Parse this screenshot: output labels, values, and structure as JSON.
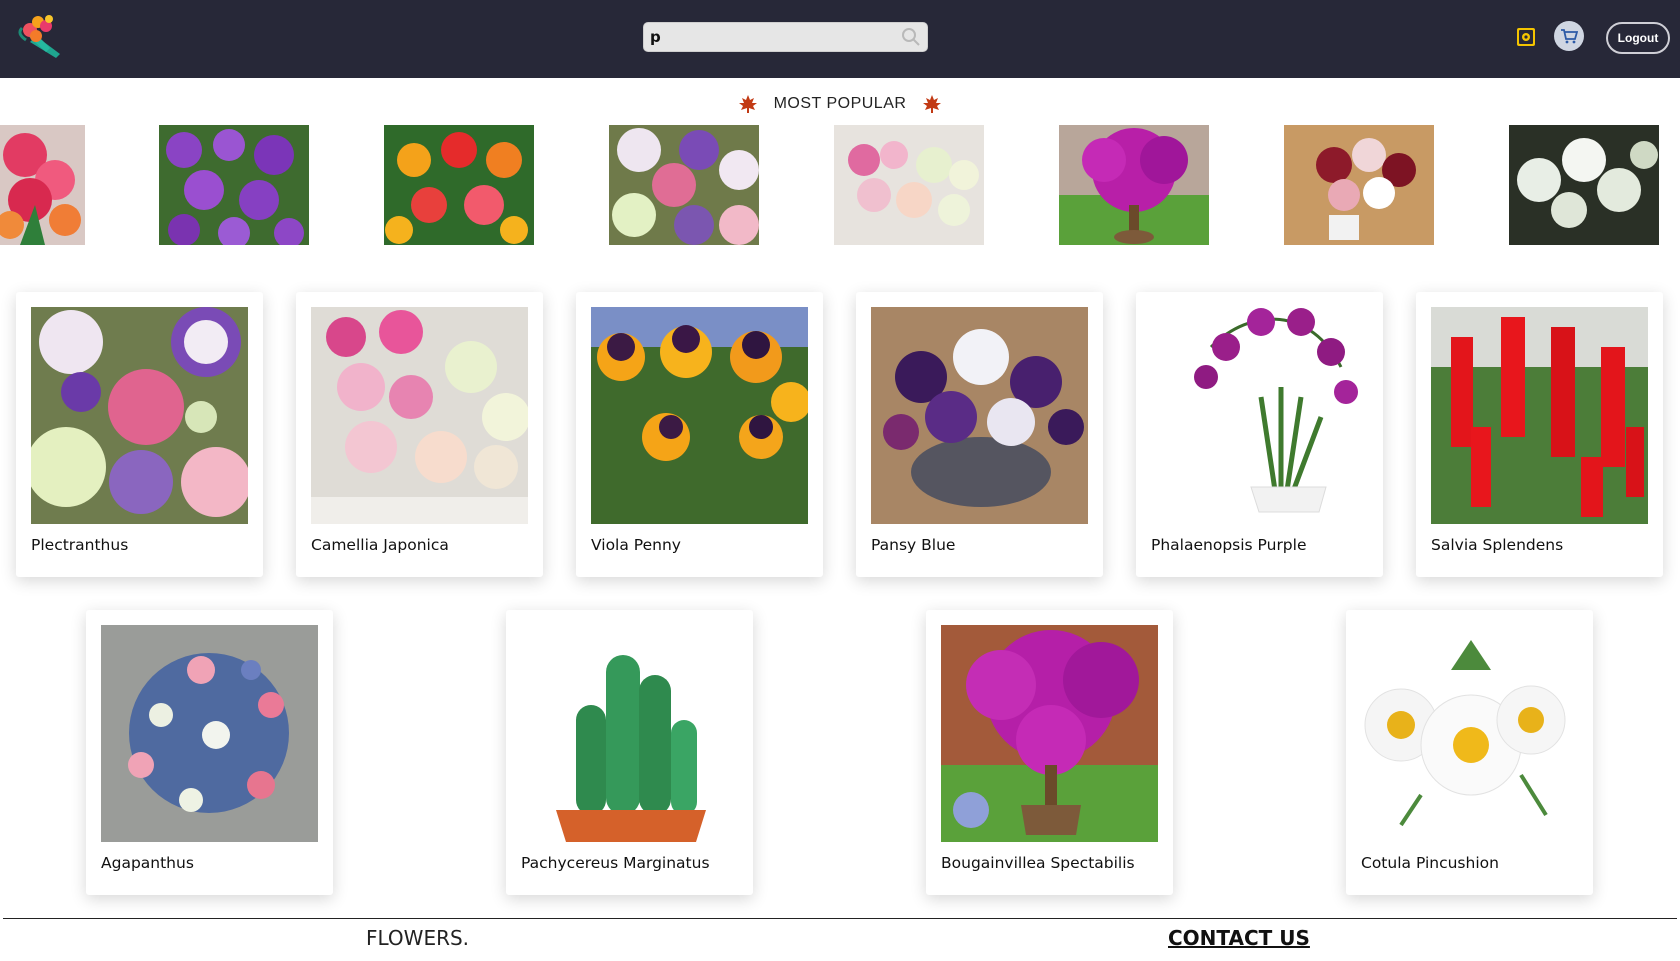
{
  "header": {
    "search_value": "p",
    "logout_label": "Logout",
    "icons": [
      "bouquet-logo",
      "search-icon",
      "admin-settings-icon",
      "cart-icon"
    ],
    "colors": {
      "header_bg": "#272838",
      "admin_icon": "#f4c400"
    }
  },
  "popular": {
    "title": "MOST POPULAR",
    "icon": "maple-leaf-icon",
    "images": [
      "alstroemeria",
      "tibouchina",
      "impatiens-mix",
      "lisianthus",
      "ranunculus",
      "bougainvillea-tree",
      "rose-arrangement",
      "white-roses"
    ]
  },
  "products": [
    {
      "name": "Plectranthus",
      "image": "lisianthus-bouquet"
    },
    {
      "name": "Camellia Japonica",
      "image": "ranunculus-pink-white"
    },
    {
      "name": "Viola Penny",
      "image": "yellow-purple-violas"
    },
    {
      "name": "Pansy Blue",
      "image": "purple-white-pansies"
    },
    {
      "name": "Phalaenopsis Purple",
      "image": "purple-orchid"
    },
    {
      "name": "Salvia Splendens",
      "image": "red-salvia"
    },
    {
      "name": "Agapanthus",
      "image": "agapanthus-bouquet"
    },
    {
      "name": "Pachycereus Marginatus",
      "image": "cactus-pot"
    },
    {
      "name": "Bougainvillea Spectabilis",
      "image": "bougainvillea-tree"
    },
    {
      "name": "Cotula Pincushion",
      "image": "white-daisies"
    }
  ],
  "footer": {
    "brand": "FLOWERS.",
    "contact": "CONTACT US"
  }
}
